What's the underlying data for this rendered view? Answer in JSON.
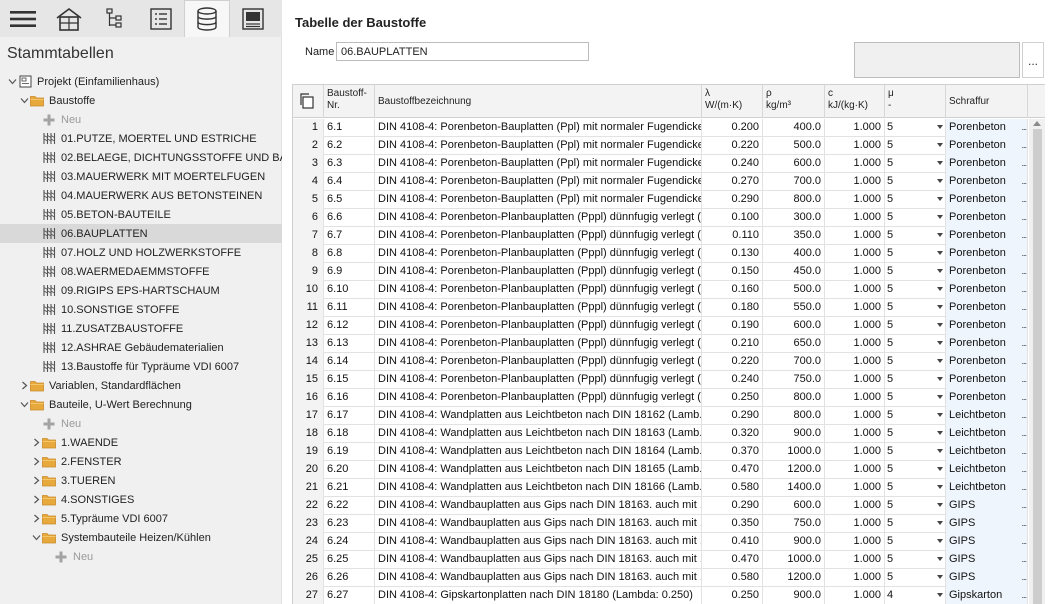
{
  "left": {
    "toolbar": [
      {
        "name": "menu-button",
        "icon": "hamburger-icon"
      },
      {
        "name": "building-button",
        "icon": "building-icon"
      },
      {
        "name": "hierarchy-button",
        "icon": "hierarchy-icon"
      },
      {
        "name": "list-button",
        "icon": "list-icon"
      },
      {
        "name": "database-button",
        "icon": "database-icon",
        "active": true
      },
      {
        "name": "settings-panel-button",
        "icon": "panel-icon"
      }
    ],
    "title": "Stammtabellen",
    "tree": [
      {
        "label": "Projekt (Einfamilienhaus)",
        "level": 0,
        "twisty": "open",
        "icon": "project-icon"
      },
      {
        "label": "Baustoffe",
        "level": 1,
        "twisty": "open",
        "icon": "folder-icon"
      },
      {
        "label": "Neu",
        "level": 2,
        "twisty": "",
        "icon": "plus-icon",
        "neu": true
      },
      {
        "label": "01.PUTZE, MOERTEL UND ESTRICHE",
        "level": 2,
        "twisty": "",
        "icon": "table-icon"
      },
      {
        "label": "02.BELAEGE, DICHTUNGSSTOFFE UND BAHNEN",
        "level": 2,
        "twisty": "",
        "icon": "table-icon"
      },
      {
        "label": "03.MAUERWERK MIT MOERTELFUGEN",
        "level": 2,
        "twisty": "",
        "icon": "table-icon"
      },
      {
        "label": "04.MAUERWERK AUS BETONSTEINEN",
        "level": 2,
        "twisty": "",
        "icon": "table-icon"
      },
      {
        "label": "05.BETON-BAUTEILE",
        "level": 2,
        "twisty": "",
        "icon": "table-icon"
      },
      {
        "label": "06.BAUPLATTEN",
        "level": 2,
        "twisty": "",
        "icon": "table-icon",
        "selected": true
      },
      {
        "label": "07.HOLZ UND HOLZWERKSTOFFE",
        "level": 2,
        "twisty": "",
        "icon": "table-icon"
      },
      {
        "label": "08.WAERMEDAEMMSTOFFE",
        "level": 2,
        "twisty": "",
        "icon": "table-icon"
      },
      {
        "label": "09.RIGIPS EPS-HARTSCHAUM",
        "level": 2,
        "twisty": "",
        "icon": "table-icon"
      },
      {
        "label": "10.SONSTIGE STOFFE",
        "level": 2,
        "twisty": "",
        "icon": "table-icon"
      },
      {
        "label": "11.ZUSATZBAUSTOFFE",
        "level": 2,
        "twisty": "",
        "icon": "table-icon"
      },
      {
        "label": "12.ASHRAE Gebäudematerialien",
        "level": 2,
        "twisty": "",
        "icon": "table-icon"
      },
      {
        "label": "13.Baustoffe für Typräume VDI 6007",
        "level": 2,
        "twisty": "",
        "icon": "table-icon"
      },
      {
        "label": "Variablen, Standardflächen",
        "level": 1,
        "twisty": "closed",
        "icon": "folder-icon"
      },
      {
        "label": "Bauteile, U-Wert Berechnung",
        "level": 1,
        "twisty": "open",
        "icon": "folder-icon"
      },
      {
        "label": "Neu",
        "level": 2,
        "twisty": "",
        "icon": "plus-icon",
        "neu": true
      },
      {
        "label": "1.WAENDE",
        "level": 2,
        "twisty": "closed",
        "icon": "folder-icon"
      },
      {
        "label": "2.FENSTER",
        "level": 2,
        "twisty": "closed",
        "icon": "folder-icon"
      },
      {
        "label": "3.TUEREN",
        "level": 2,
        "twisty": "closed",
        "icon": "folder-icon"
      },
      {
        "label": "4.SONSTIGES",
        "level": 2,
        "twisty": "closed",
        "icon": "folder-icon"
      },
      {
        "label": "5.Typräume VDI 6007",
        "level": 2,
        "twisty": "closed",
        "icon": "folder-icon"
      },
      {
        "label": "Systembauteile Heizen/Kühlen",
        "level": 2,
        "twisty": "open",
        "icon": "folder-icon"
      },
      {
        "label": "Neu",
        "level": 3,
        "twisty": "",
        "icon": "plus-icon",
        "neu": true
      }
    ]
  },
  "main": {
    "title": "Tabelle der Baustoffe",
    "name_label": "Name",
    "name_value": "06.BAUPLATTEN",
    "preview_button": "...",
    "headers": {
      "nr": "Baustoff-\nNr.",
      "bez": "Baustoffbezeichnung",
      "lambda": "λ\nW/(m·K)",
      "rho": "ρ\nkg/m³",
      "c": "c\nkJ/(kg·K)",
      "mu": "μ\n-",
      "schraffur": "Schraffur"
    },
    "rows": [
      {
        "n": "1",
        "nr": "6.1",
        "bez": "DIN 4108-4: Porenbeton-Bauplatten (Ppl) mit normaler Fugendicke ...",
        "lambda": "0.200",
        "rho": "400.0",
        "c": "1.000",
        "mu": "5",
        "s": "Porenbeton"
      },
      {
        "n": "2",
        "nr": "6.2",
        "bez": "DIN 4108-4: Porenbeton-Bauplatten (Ppl) mit normaler Fugendicke ...",
        "lambda": "0.220",
        "rho": "500.0",
        "c": "1.000",
        "mu": "5",
        "s": "Porenbeton"
      },
      {
        "n": "3",
        "nr": "6.3",
        "bez": "DIN 4108-4: Porenbeton-Bauplatten (Ppl) mit normaler Fugendicke ...",
        "lambda": "0.240",
        "rho": "600.0",
        "c": "1.000",
        "mu": "5",
        "s": "Porenbeton"
      },
      {
        "n": "4",
        "nr": "6.4",
        "bez": "DIN 4108-4: Porenbeton-Bauplatten (Ppl) mit normaler Fugendicke ...",
        "lambda": "0.270",
        "rho": "700.0",
        "c": "1.000",
        "mu": "5",
        "s": "Porenbeton"
      },
      {
        "n": "5",
        "nr": "6.5",
        "bez": "DIN 4108-4: Porenbeton-Bauplatten (Ppl) mit normaler Fugendicke ...",
        "lambda": "0.290",
        "rho": "800.0",
        "c": "1.000",
        "mu": "5",
        "s": "Porenbeton"
      },
      {
        "n": "6",
        "nr": "6.6",
        "bez": "DIN 4108-4: Porenbeton-Planbauplatten (Pppl) dünnfugig verlegt (L...",
        "lambda": "0.100",
        "rho": "300.0",
        "c": "1.000",
        "mu": "5",
        "s": "Porenbeton"
      },
      {
        "n": "7",
        "nr": "6.7",
        "bez": "DIN 4108-4: Porenbeton-Planbauplatten (Pppl) dünnfugig verlegt (L...",
        "lambda": "0.110",
        "rho": "350.0",
        "c": "1.000",
        "mu": "5",
        "s": "Porenbeton"
      },
      {
        "n": "8",
        "nr": "6.8",
        "bez": "DIN 4108-4: Porenbeton-Planbauplatten (Pppl) dünnfugig verlegt (L...",
        "lambda": "0.130",
        "rho": "400.0",
        "c": "1.000",
        "mu": "5",
        "s": "Porenbeton"
      },
      {
        "n": "9",
        "nr": "6.9",
        "bez": "DIN 4108-4: Porenbeton-Planbauplatten (Pppl) dünnfugig verlegt (L...",
        "lambda": "0.150",
        "rho": "450.0",
        "c": "1.000",
        "mu": "5",
        "s": "Porenbeton"
      },
      {
        "n": "10",
        "nr": "6.10",
        "bez": "DIN 4108-4: Porenbeton-Planbauplatten (Pppl) dünnfugig verlegt (L...",
        "lambda": "0.160",
        "rho": "500.0",
        "c": "1.000",
        "mu": "5",
        "s": "Porenbeton"
      },
      {
        "n": "11",
        "nr": "6.11",
        "bez": "DIN 4108-4: Porenbeton-Planbauplatten (Pppl) dünnfugig verlegt (L...",
        "lambda": "0.180",
        "rho": "550.0",
        "c": "1.000",
        "mu": "5",
        "s": "Porenbeton"
      },
      {
        "n": "12",
        "nr": "6.12",
        "bez": "DIN 4108-4: Porenbeton-Planbauplatten (Pppl) dünnfugig verlegt (L...",
        "lambda": "0.190",
        "rho": "600.0",
        "c": "1.000",
        "mu": "5",
        "s": "Porenbeton"
      },
      {
        "n": "13",
        "nr": "6.13",
        "bez": "DIN 4108-4: Porenbeton-Planbauplatten (Pppl) dünnfugig verlegt (L...",
        "lambda": "0.210",
        "rho": "650.0",
        "c": "1.000",
        "mu": "5",
        "s": "Porenbeton"
      },
      {
        "n": "14",
        "nr": "6.14",
        "bez": "DIN 4108-4: Porenbeton-Planbauplatten (Pppl) dünnfugig verlegt (L...",
        "lambda": "0.220",
        "rho": "700.0",
        "c": "1.000",
        "mu": "5",
        "s": "Porenbeton"
      },
      {
        "n": "15",
        "nr": "6.15",
        "bez": "DIN 4108-4: Porenbeton-Planbauplatten (Pppl) dünnfugig verlegt (L...",
        "lambda": "0.240",
        "rho": "750.0",
        "c": "1.000",
        "mu": "5",
        "s": "Porenbeton"
      },
      {
        "n": "16",
        "nr": "6.16",
        "bez": "DIN 4108-4: Porenbeton-Planbauplatten (Pppl) dünnfugig verlegt (L...",
        "lambda": "0.250",
        "rho": "800.0",
        "c": "1.000",
        "mu": "5",
        "s": "Porenbeton"
      },
      {
        "n": "17",
        "nr": "6.17",
        "bez": "DIN 4108-4: Wandplatten aus Leichtbeton nach DIN 18162 (Lamb...",
        "lambda": "0.290",
        "rho": "800.0",
        "c": "1.000",
        "mu": "5",
        "s": "Leichtbeton"
      },
      {
        "n": "18",
        "nr": "6.18",
        "bez": "DIN 4108-4: Wandplatten aus Leichtbeton nach DIN 18163 (Lamb...",
        "lambda": "0.320",
        "rho": "900.0",
        "c": "1.000",
        "mu": "5",
        "s": "Leichtbeton"
      },
      {
        "n": "19",
        "nr": "6.19",
        "bez": "DIN 4108-4: Wandplatten aus Leichtbeton nach DIN 18164 (Lamb...",
        "lambda": "0.370",
        "rho": "1000.0",
        "c": "1.000",
        "mu": "5",
        "s": "Leichtbeton"
      },
      {
        "n": "20",
        "nr": "6.20",
        "bez": "DIN 4108-4: Wandplatten aus Leichtbeton nach DIN 18165 (Lamb...",
        "lambda": "0.470",
        "rho": "1200.0",
        "c": "1.000",
        "mu": "5",
        "s": "Leichtbeton"
      },
      {
        "n": "21",
        "nr": "6.21",
        "bez": "DIN 4108-4: Wandplatten aus Leichtbeton nach DIN 18166 (Lamb...",
        "lambda": "0.580",
        "rho": "1400.0",
        "c": "1.000",
        "mu": "5",
        "s": "Leichtbeton"
      },
      {
        "n": "22",
        "nr": "6.22",
        "bez": "DIN 4108-4: Wandbauplatten aus Gips nach DIN 18163. auch mit ...",
        "lambda": "0.290",
        "rho": "600.0",
        "c": "1.000",
        "mu": "5",
        "s": "GIPS"
      },
      {
        "n": "23",
        "nr": "6.23",
        "bez": "DIN 4108-4: Wandbauplatten aus Gips nach DIN 18163. auch mit ...",
        "lambda": "0.350",
        "rho": "750.0",
        "c": "1.000",
        "mu": "5",
        "s": "GIPS"
      },
      {
        "n": "24",
        "nr": "6.24",
        "bez": "DIN 4108-4: Wandbauplatten aus Gips nach DIN 18163. auch mit ...",
        "lambda": "0.410",
        "rho": "900.0",
        "c": "1.000",
        "mu": "5",
        "s": "GIPS"
      },
      {
        "n": "25",
        "nr": "6.25",
        "bez": "DIN 4108-4: Wandbauplatten aus Gips nach DIN 18163. auch mit ...",
        "lambda": "0.470",
        "rho": "1000.0",
        "c": "1.000",
        "mu": "5",
        "s": "GIPS"
      },
      {
        "n": "26",
        "nr": "6.26",
        "bez": "DIN 4108-4: Wandbauplatten aus Gips nach DIN 18163. auch mit ...",
        "lambda": "0.580",
        "rho": "1200.0",
        "c": "1.000",
        "mu": "5",
        "s": "GIPS"
      },
      {
        "n": "27",
        "nr": "6.27",
        "bez": "DIN 4108-4: Gipskartonplatten nach DIN 18180 (Lambda: 0.250)",
        "lambda": "0.250",
        "rho": "900.0",
        "c": "1.000",
        "mu": "4",
        "s": "Gipskarton"
      }
    ]
  },
  "colors": {
    "folder": "#e8a93c",
    "selection": "#d9d9d9",
    "hatch_cell": "#eef5fc"
  }
}
